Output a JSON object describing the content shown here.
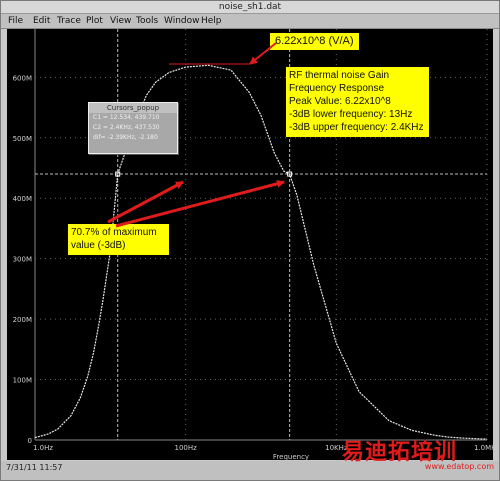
{
  "window": {
    "title": "noise_sh1.dat"
  },
  "menu": [
    "File",
    "Edit",
    "Trace",
    "Plot",
    "View",
    "Tools",
    "Window",
    "Help"
  ],
  "status_text": "7/31/11 11:57",
  "popup": {
    "title": "Cursors_popup",
    "rows": [
      "C1 = 12.534, 439.710",
      "C2 = 2.4KHz, 437.530",
      "dif= -2.39KHz, -2.180"
    ]
  },
  "annotations": {
    "peak_label": "6.22x10^8 (V/A)",
    "info_box": [
      "RF thermal noise Gain",
      "Frequency Response",
      "Peak Value: 6.22x10^8",
      "-3dB lower frequency: 13Hz",
      "-3dB upper frequency: 2.4KHz"
    ],
    "threshold_box": [
      "70.7% of maximum",
      "value (-3dB)"
    ]
  },
  "chart_data": {
    "type": "line",
    "xscale": "log",
    "xlabel": "Frequency",
    "ylabel": "",
    "x_ticks": [
      "1.0Hz",
      "100Hz",
      "10KHz",
      "1.0MHz"
    ],
    "y_ticks": [
      "0",
      "100M",
      "200M",
      "300M",
      "400M",
      "500M",
      "600M"
    ],
    "xlim": [
      1,
      1000000
    ],
    "ylim": [
      0,
      680000000
    ],
    "series": [
      {
        "x": [
          1,
          1.5,
          2,
          3,
          4,
          5,
          6,
          7,
          8,
          10,
          12.53,
          15,
          20,
          30,
          40,
          60,
          100,
          200,
          400,
          700,
          1000,
          1500,
          2000,
          2400,
          3000,
          5000,
          10000,
          20000,
          50000,
          100000,
          200000,
          300000,
          500000,
          1000000
        ],
        "y": [
          4000000,
          10000000,
          18000000,
          40000000,
          70000000,
          105000000,
          145000000,
          190000000,
          232000000,
          312000000,
          440000000,
          468000000,
          515000000,
          570000000,
          592000000,
          608000000,
          617000000,
          620000000,
          612000000,
          575000000,
          537000000,
          475000000,
          445000000,
          440000000,
          405000000,
          290000000,
          160000000,
          80000000,
          32000000,
          16000000,
          8000000,
          5000000,
          3000000,
          1500000
        ],
        "color": "#e8e8e8"
      }
    ],
    "cursor_x": [
      12.53,
      2400
    ],
    "cursor_y": 440000000,
    "peak_y": 622000000,
    "grid": "dotted"
  },
  "watermark": {
    "text": "易迪拓培训",
    "url": "www.edatop.com"
  },
  "colors": {
    "plot_bg": "#000000",
    "grid": "#666666",
    "cursor": "#bbbbbb",
    "curve": "#e8e8e8",
    "annotation_fill": "#ffff00",
    "arrow": "#e01b1b"
  }
}
